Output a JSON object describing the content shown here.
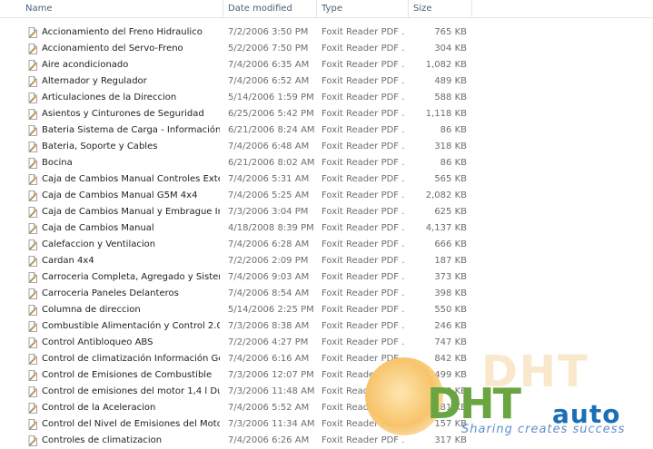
{
  "columns": {
    "name": "Name",
    "date": "Date modified",
    "type": "Type",
    "size": "Size"
  },
  "files": [
    {
      "name": "Accionamiento del Freno Hidraulico",
      "date": "7/2/2006 3:50 PM",
      "type": "Foxit Reader PDF ...",
      "size": "765 KB"
    },
    {
      "name": "Accionamiento del Servo-Freno",
      "date": "5/2/2006 7:50 PM",
      "type": "Foxit Reader PDF ...",
      "size": "304 KB"
    },
    {
      "name": "Aire acondicionado",
      "date": "7/4/2006 6:35 AM",
      "type": "Foxit Reader PDF ...",
      "size": "1,082 KB"
    },
    {
      "name": "Alternador y Regulador",
      "date": "7/4/2006 6:52 AM",
      "type": "Foxit Reader PDF ...",
      "size": "489 KB"
    },
    {
      "name": "Articulaciones de la Direccion",
      "date": "5/14/2006 1:59 PM",
      "type": "Foxit Reader PDF ...",
      "size": "588 KB"
    },
    {
      "name": "Asientos y Cinturones de Seguridad",
      "date": "6/25/2006 5:42 PM",
      "type": "Foxit Reader PDF ...",
      "size": "1,118 KB"
    },
    {
      "name": "Bateria Sistema de Carga - Información G...",
      "date": "6/21/2006 8:24 AM",
      "type": "Foxit Reader PDF ...",
      "size": "86 KB"
    },
    {
      "name": "Bateria, Soporte y Cables",
      "date": "7/4/2006 6:48 AM",
      "type": "Foxit Reader PDF ...",
      "size": "318 KB"
    },
    {
      "name": "Bocina",
      "date": "6/21/2006 8:02 AM",
      "type": "Foxit Reader PDF ...",
      "size": "86 KB"
    },
    {
      "name": "Caja de Cambios Manual Controles Exter...",
      "date": "7/4/2006 5:31 AM",
      "type": "Foxit Reader PDF ...",
      "size": "565 KB"
    },
    {
      "name": "Caja de Cambios Manual G5M 4x4",
      "date": "7/4/2006 5:25 AM",
      "type": "Foxit Reader PDF ...",
      "size": "2,082 KB"
    },
    {
      "name": "Caja de Cambios Manual y Embrague Inf...",
      "date": "7/3/2006 3:04 PM",
      "type": "Foxit Reader PDF ...",
      "size": "625 KB"
    },
    {
      "name": "Caja de Cambios Manual",
      "date": "4/18/2008 8:39 PM",
      "type": "Foxit Reader PDF ...",
      "size": "4,137 KB"
    },
    {
      "name": "Calefaccion y Ventilacion",
      "date": "7/4/2006 6:28 AM",
      "type": "Foxit Reader PDF ...",
      "size": "666 KB"
    },
    {
      "name": "Cardan 4x4",
      "date": "7/2/2006 2:09 PM",
      "type": "Foxit Reader PDF ...",
      "size": "187 KB"
    },
    {
      "name": "Carroceria Completa, Agregado y Sistem...",
      "date": "7/4/2006 9:03 AM",
      "type": "Foxit Reader PDF ...",
      "size": "373 KB"
    },
    {
      "name": "Carroceria Paneles Delanteros",
      "date": "7/4/2006 8:54 AM",
      "type": "Foxit Reader PDF ...",
      "size": "398 KB"
    },
    {
      "name": "Columna de direccion",
      "date": "5/14/2006 2:25 PM",
      "type": "Foxit Reader PDF ...",
      "size": "550 KB"
    },
    {
      "name": "Combustible Alimentación y Control 2.0...",
      "date": "7/3/2006 8:38 AM",
      "type": "Foxit Reader PDF ...",
      "size": "246 KB"
    },
    {
      "name": "Control Antibloqueo ABS",
      "date": "7/2/2006 4:27 PM",
      "type": "Foxit Reader PDF ...",
      "size": "747 KB"
    },
    {
      "name": "Control de climatización Información Ge...",
      "date": "7/4/2006 6:16 AM",
      "type": "Foxit Reader PDF ...",
      "size": "842 KB"
    },
    {
      "name": "Control de Emisiones de Combustible",
      "date": "7/3/2006 12:07 PM",
      "type": "Foxit Reader PDF ...",
      "size": "499 KB"
    },
    {
      "name": "Control de emisiones del motor 1,4 l Dur...",
      "date": "7/3/2006 11:48 AM",
      "type": "Foxit Reader PDF ...",
      "size": "300 KB"
    },
    {
      "name": "Control de la Aceleracion",
      "date": "7/4/2006 5:52 AM",
      "type": "Foxit Reader PDF ...",
      "size": "181 KB"
    },
    {
      "name": "Control del Nivel de Emisiones del Motor...",
      "date": "7/3/2006 11:34 AM",
      "type": "Foxit Reader PDF ...",
      "size": "157 KB"
    },
    {
      "name": "Controles de climatizacion",
      "date": "7/4/2006 6:26 AM",
      "type": "Foxit Reader PDF ...",
      "size": "317 KB"
    }
  ],
  "watermark": {
    "brand_big": "DHT",
    "brand_auto": "auto",
    "slogan": "Sharing creates success",
    "colors": {
      "green": "#6aa541",
      "blue": "#1b6fb5",
      "orange": "#f7c46b"
    }
  }
}
